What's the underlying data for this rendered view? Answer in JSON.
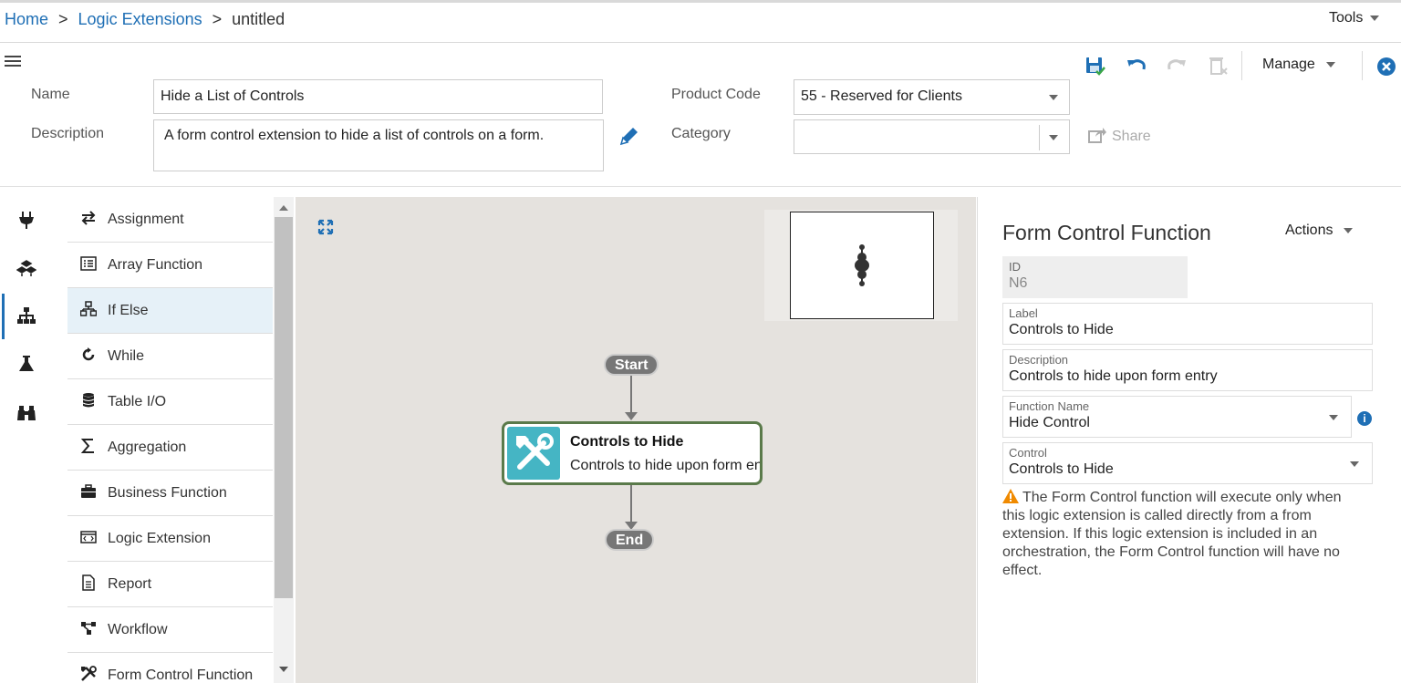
{
  "breadcrumb": {
    "home": "Home",
    "sep1": ">",
    "logic_extensions": "Logic Extensions",
    "sep2": ">",
    "current": "untitled"
  },
  "tools_label": "Tools",
  "header": {
    "name_label": "Name",
    "name_value": "Hide a List of Controls",
    "description_label": "Description",
    "description_value": "A form control extension to hide a list of controls on a form.",
    "product_code_label": "Product Code",
    "product_code_value": "55 - Reserved for Clients",
    "category_label": "Category",
    "category_value": "",
    "share_label": "Share",
    "manage_label": "Manage"
  },
  "palette": [
    {
      "label": "Assignment",
      "icon": "swap-arrows-icon"
    },
    {
      "label": "Array Function",
      "icon": "list-icon"
    },
    {
      "label": "If Else",
      "icon": "hierarchy-icon",
      "selected": true
    },
    {
      "label": "While",
      "icon": "loop-icon"
    },
    {
      "label": "Table I/O",
      "icon": "database-icon"
    },
    {
      "label": "Aggregation",
      "icon": "sigma-icon"
    },
    {
      "label": "Business Function",
      "icon": "briefcase-icon"
    },
    {
      "label": "Logic Extension",
      "icon": "code-window-icon"
    },
    {
      "label": "Report",
      "icon": "report-icon"
    },
    {
      "label": "Workflow",
      "icon": "workflow-icon"
    },
    {
      "label": "Form Control Function",
      "icon": "tools-icon"
    }
  ],
  "canvas": {
    "start_label": "Start",
    "end_label": "End",
    "node_title": "Controls to Hide",
    "node_desc": "Controls to hide upon form entry"
  },
  "properties": {
    "title": "Form Control Function",
    "actions_label": "Actions",
    "id_label": "ID",
    "id_value": "N6",
    "label_label": "Label",
    "label_value": "Controls to Hide",
    "description_label": "Description",
    "description_value": "Controls to hide upon form entry",
    "function_name_label": "Function Name",
    "function_name_value": "Hide Control",
    "control_label": "Control",
    "control_value": "Controls to Hide",
    "warning": "The Form Control function will execute only when this logic extension is called directly from a from extension. If this logic extension is included in an orchestration, the Form Control function will have no effect."
  },
  "colors": {
    "accent": "#1f6fb5",
    "canvas": "#e5e2de",
    "node_border": "#5a7a4a",
    "node_icon": "#45b5c4",
    "warning": "#f08a00"
  }
}
